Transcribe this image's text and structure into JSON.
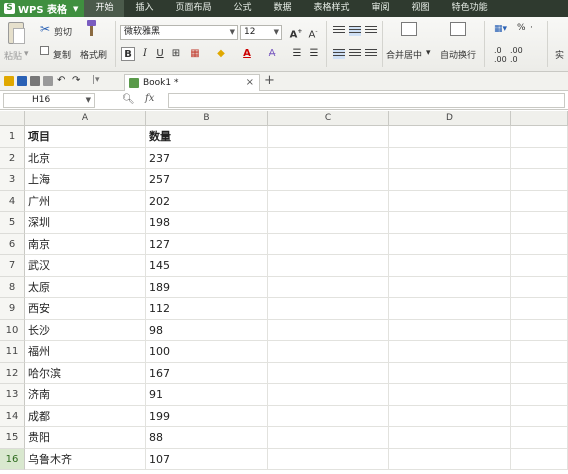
{
  "app": {
    "name": "WPS 表格"
  },
  "menu_tabs": [
    "开始",
    "插入",
    "页面布局",
    "公式",
    "数据",
    "表格样式",
    "审阅",
    "视图",
    "特色功能"
  ],
  "ribbon": {
    "cut": "剪切",
    "paste": "粘贴",
    "copy": "复制",
    "format_painter": "格式刷",
    "font_name": "微软雅黑",
    "font_size": "12",
    "merge_center": "合并居中",
    "wrap_text": "自动换行",
    "percent": "%",
    "truncated": "实"
  },
  "quick_access": {
    "doc_tab": "Book1 *"
  },
  "formula_bar": {
    "name_box": "H16",
    "fx": "fx",
    "formula": ""
  },
  "columns": [
    "A",
    "B",
    "C",
    "D"
  ],
  "rows": [
    {
      "n": "1",
      "a": "项目",
      "b": "数量"
    },
    {
      "n": "2",
      "a": "北京",
      "b": "237"
    },
    {
      "n": "3",
      "a": "上海",
      "b": "257"
    },
    {
      "n": "4",
      "a": "广州",
      "b": "202"
    },
    {
      "n": "5",
      "a": "深圳",
      "b": "198"
    },
    {
      "n": "6",
      "a": "南京",
      "b": "127"
    },
    {
      "n": "7",
      "a": "武汉",
      "b": "145"
    },
    {
      "n": "8",
      "a": "太原",
      "b": "189"
    },
    {
      "n": "9",
      "a": "西安",
      "b": "112"
    },
    {
      "n": "10",
      "a": "长沙",
      "b": "98"
    },
    {
      "n": "11",
      "a": "福州",
      "b": "100"
    },
    {
      "n": "12",
      "a": "哈尔滨",
      "b": "167"
    },
    {
      "n": "13",
      "a": "济南",
      "b": "91"
    },
    {
      "n": "14",
      "a": "成都",
      "b": "199"
    },
    {
      "n": "15",
      "a": "贵阳",
      "b": "88"
    },
    {
      "n": "16",
      "a": "乌鲁木齐",
      "b": "107"
    }
  ],
  "selected_row": "16",
  "colors": {
    "menubar": "#2f3a2f",
    "app_button": "#3f8f3f",
    "selected_row_header": "#d9e8cf"
  }
}
